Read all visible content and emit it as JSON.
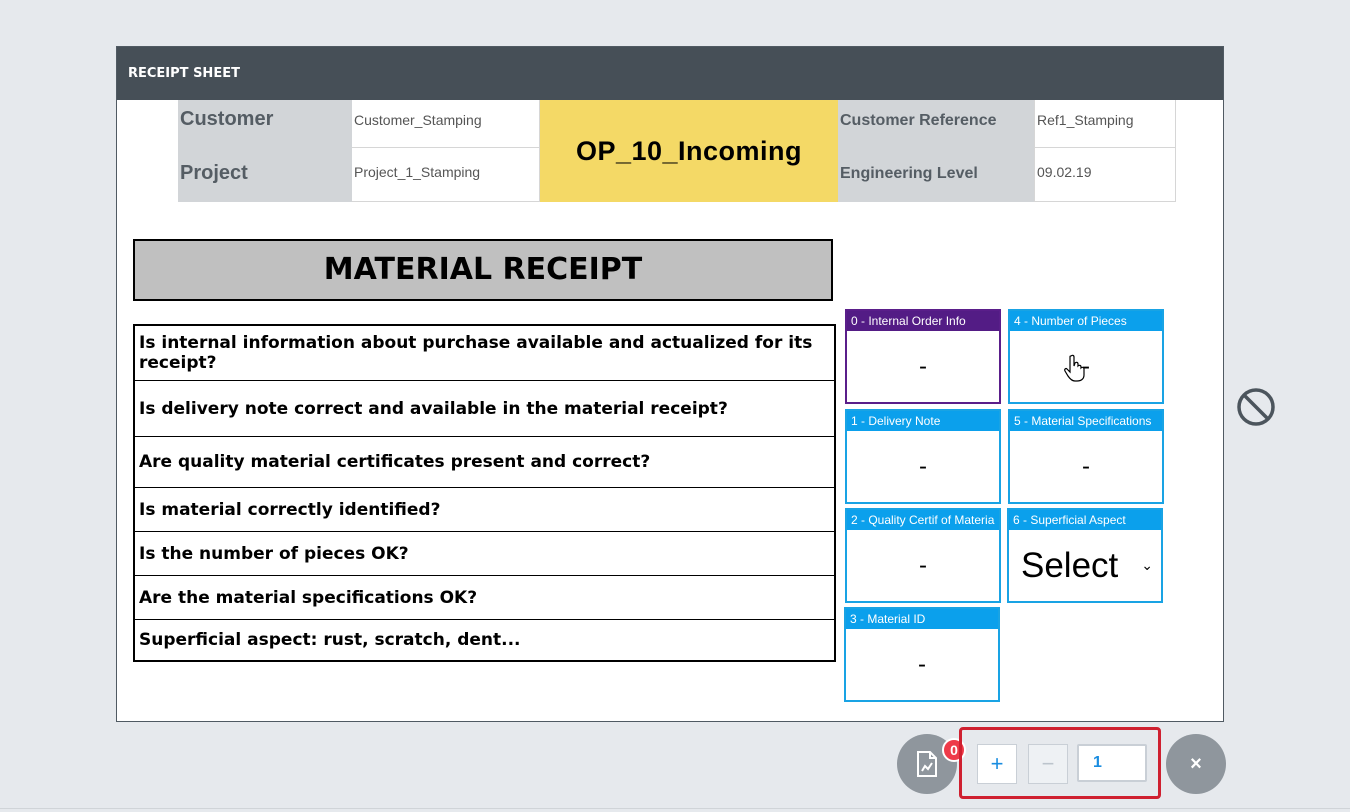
{
  "sheet": {
    "title": "RECEIPT SHEET"
  },
  "info": {
    "customer_label": "Customer",
    "customer_value": "Customer_Stamping",
    "project_label": "Project",
    "project_value": "Project_1_Stamping",
    "operation": "OP_10_Incoming",
    "customer_ref_label": "Customer Reference",
    "customer_ref_value": "Ref1_Stamping",
    "eng_level_label": "Engineering Level",
    "eng_level_value": "09.02.19"
  },
  "material_receipt": {
    "title": "MATERIAL RECEIPT",
    "questions": [
      "Is internal information about purchase available and actualized for its receipt?",
      "Is delivery note correct and available in the material receipt?",
      "Are quality material certificates present and correct?",
      "Is material correctly identified?",
      "Is the number of pieces OK?",
      "Are the material specifications OK?",
      "Superficial aspect: rust, scratch, dent..."
    ]
  },
  "cards": [
    {
      "title": "0 - Internal Order Info",
      "value": "-"
    },
    {
      "title": "1 - Delivery Note",
      "value": "-"
    },
    {
      "title": "2 - Quality Certif of Materia",
      "value": "-"
    },
    {
      "title": "3 - Material ID",
      "value": "-"
    },
    {
      "title": "4 - Number of Pieces",
      "value": "-"
    },
    {
      "title": "5 - Material Specifications",
      "value": "-"
    },
    {
      "title": "6 - Superficial Aspect",
      "value": "Select"
    }
  ],
  "controls": {
    "badge_count": "0",
    "plus_label": "+",
    "minus_label": "−",
    "quantity": "1",
    "close_label": "×"
  },
  "colors": {
    "header": "#464f57",
    "operation_bg": "#f4d966",
    "card_blue": "#0ba0ec",
    "card_purple": "#531c85",
    "highlight_red": "#cf2030"
  },
  "icons": [
    "block-icon",
    "document-chart-icon",
    "chevron-down-icon",
    "hand-cursor-icon"
  ]
}
